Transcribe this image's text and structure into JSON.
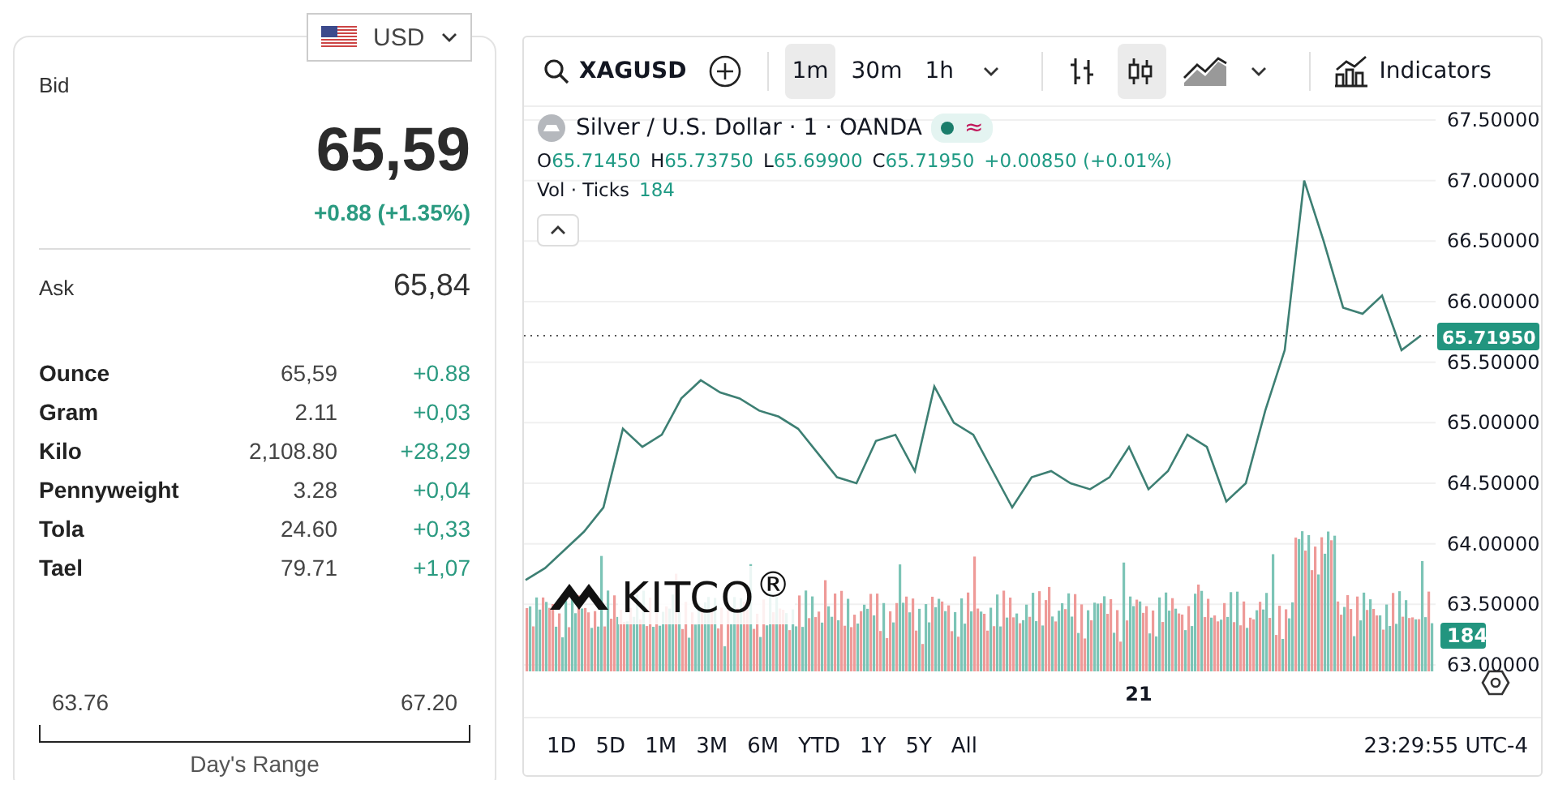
{
  "currency": {
    "label": "USD"
  },
  "quote": {
    "bid_label": "Bid",
    "bid": "65,59",
    "change": "+0.88 (+1.35%)",
    "ask_label": "Ask",
    "ask": "65,84"
  },
  "units": [
    {
      "name": "Ounce",
      "price": "65,59",
      "change": "+0.88"
    },
    {
      "name": "Gram",
      "price": "2.11",
      "change": "+0,03"
    },
    {
      "name": "Kilo",
      "price": "2,108.80",
      "change": "+28,29"
    },
    {
      "name": "Pennyweight",
      "price": "3.28",
      "change": "+0,04"
    },
    {
      "name": "Tola",
      "price": "24.60",
      "change": "+0,33"
    },
    {
      "name": "Tael",
      "price": "79.71",
      "change": "+1,07"
    }
  ],
  "day_range": {
    "low": "63.76",
    "high": "67.20",
    "label": "Day's Range"
  },
  "toolbar": {
    "symbol": "XAGUSD",
    "intervals": [
      {
        "label": "1m",
        "selected": true
      },
      {
        "label": "30m",
        "selected": false
      },
      {
        "label": "1h",
        "selected": false
      }
    ],
    "styles": [
      {
        "kind": "bars",
        "selected": false
      },
      {
        "kind": "candles",
        "selected": true
      },
      {
        "kind": "area",
        "selected": false
      }
    ],
    "indicators": "Indicators"
  },
  "legend": {
    "title": "Silver / U.S. Dollar · 1 · OANDA",
    "ohlc": [
      {
        "label": "O",
        "value": "65.71450"
      },
      {
        "label": "H",
        "value": "65.73750"
      },
      {
        "label": "L",
        "value": "65.69900"
      },
      {
        "label": "C",
        "value": "65.71950"
      }
    ],
    "change": "+0.00850 (+0.01%)",
    "status_symbol": "≈",
    "volume_label": "Vol · Ticks",
    "volume": "184"
  },
  "logo": "KITCO$^{®}$",
  "volume_badge": "184",
  "time_label": "21",
  "chart_data": {
    "type": "line",
    "ylim": [
      63,
      67.5
    ],
    "grid": true,
    "ref_lines": [
      {
        "axis": "y",
        "value": 65.7195,
        "label": "65.71950",
        "color": "#555555"
      }
    ],
    "yticks": [
      {
        "value": 63,
        "label": "63.00000"
      },
      {
        "value": 63.5,
        "label": "63.50000"
      },
      {
        "value": 64,
        "label": "64.00000"
      },
      {
        "value": 64.5,
        "label": "64.50000"
      },
      {
        "value": 65,
        "label": "65.00000"
      },
      {
        "value": 65.5,
        "label": "65.50000"
      },
      {
        "value": 66,
        "label": "66.00000"
      },
      {
        "value": 66.5,
        "label": "66.50000"
      },
      {
        "value": 67,
        "label": "67.00000"
      },
      {
        "value": 67.5,
        "label": "67.50000"
      }
    ],
    "series": [
      {
        "color": "#3d7f73",
        "values": [
          63.7,
          63.8,
          63.95,
          64.1,
          64.3,
          64.95,
          64.8,
          64.9,
          65.2,
          65.35,
          65.25,
          65.2,
          65.1,
          65.05,
          64.95,
          64.75,
          64.55,
          64.5,
          64.85,
          64.9,
          64.6,
          65.3,
          65.0,
          64.9,
          64.6,
          64.3,
          64.55,
          64.6,
          64.5,
          64.45,
          64.55,
          64.8,
          64.45,
          64.6,
          64.9,
          64.8,
          64.35,
          64.5,
          65.1,
          65.6,
          67.0,
          66.5,
          65.95,
          65.9,
          66.05,
          65.6,
          65.72
        ]
      }
    ]
  },
  "ranges": [
    "1D",
    "5D",
    "1M",
    "3M",
    "6M",
    "YTD",
    "1Y",
    "5Y",
    "All"
  ],
  "clock": "23:29:55 UTC-4"
}
